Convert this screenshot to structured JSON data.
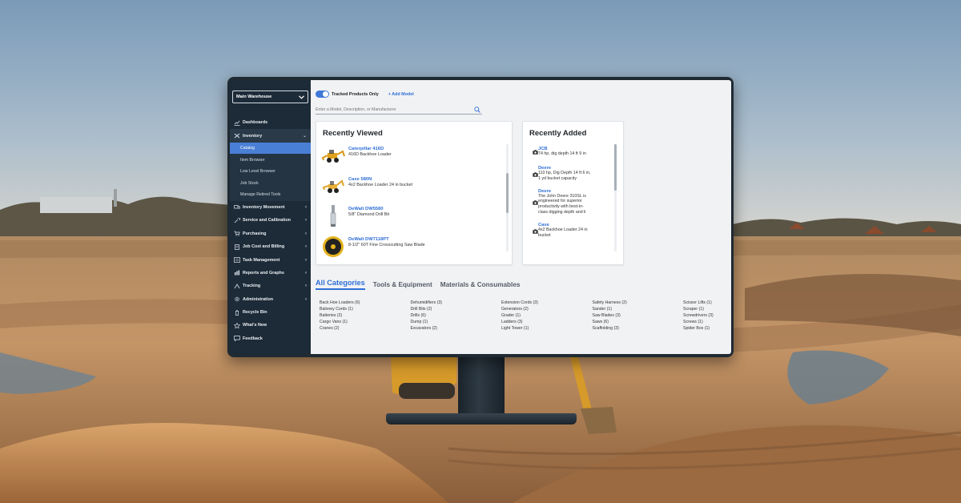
{
  "sidebar": {
    "warehouse": "Main Warehouse",
    "items": [
      {
        "label": "Dashboards",
        "icon": "chart-icon"
      },
      {
        "label": "Inventory",
        "icon": "tools-icon",
        "open": true
      },
      {
        "label": "Inventory Movement",
        "icon": "truck-icon"
      },
      {
        "label": "Service and Calibration",
        "icon": "wrench-icon"
      },
      {
        "label": "Purchasing",
        "icon": "cart-icon"
      },
      {
        "label": "Job Cost and Billing",
        "icon": "document-icon"
      },
      {
        "label": "Task Management",
        "icon": "list-icon"
      },
      {
        "label": "Reports and Graphs",
        "icon": "report-icon"
      },
      {
        "label": "Tracking",
        "icon": "tracking-icon"
      },
      {
        "label": "Administration",
        "icon": "gear-icon"
      },
      {
        "label": "Recycle Bin",
        "icon": "recycle-icon"
      },
      {
        "label": "What's New",
        "icon": "star-icon"
      },
      {
        "label": "Feedback",
        "icon": "chat-icon"
      }
    ],
    "inventory_sub": [
      "Catalog",
      "Item Browser",
      "Low Level Browser",
      "Job Stock",
      "Manage Retired Tools"
    ]
  },
  "topbar": {
    "toggle_label": "Tracked Products Only",
    "add_model": "+ Add Model"
  },
  "search": {
    "placeholder": "Enter a Model, Description, or Manufacturer"
  },
  "recently_viewed": {
    "title": "Recently Viewed",
    "items": [
      {
        "name": "Caterpillar 416D",
        "desc": "416D Backhoe Loader"
      },
      {
        "name": "Case 580N",
        "desc": "4x2 Backhoe Loader 24 in bucket"
      },
      {
        "name": "DeWalt DW5580",
        "desc": "5/8\" Diamond Drill Bit"
      },
      {
        "name": "DeWalt DW7118PT",
        "desc": "8-1/2\" 60T Fine Crosscutting Saw Blade"
      }
    ]
  },
  "recently_added": {
    "title": "Recently Added",
    "items": [
      {
        "name": "JCB",
        "desc": [
          "74 hp, dig depth 14 ft 9 in"
        ]
      },
      {
        "name": "Deere",
        "desc": [
          "110 hp, Dig Depth 14 ft 6 in,",
          "1 yd bucket capacity"
        ]
      },
      {
        "name": "Deere",
        "desc": [
          "The John Deere 310SL is",
          "engineered for superior",
          "productivity with best-in-",
          "class digging depth and li"
        ]
      },
      {
        "name": "Case",
        "desc": [
          "4x2 Backhoe Loader 24 in",
          "bucket"
        ]
      }
    ]
  },
  "tabs": [
    "All Categories",
    "Tools & Equipment",
    "Materials & Consumables"
  ],
  "categories": [
    [
      "Back Hoe Loaders (6)",
      "Baloney Cords (1)",
      "Batteries (2)",
      "Cargo Vans (1)",
      "Cranes (2)"
    ],
    [
      "Dehumidifiers (3)",
      "Drill Bits (2)",
      "Drills (6)",
      "Dump (1)",
      "Excavators (2)"
    ],
    [
      "Extension Cords (3)",
      "Generators (2)",
      "Grader (1)",
      "Ladders (3)",
      "Light Tower (1)"
    ],
    [
      "Safety Harness (2)",
      "Sander (1)",
      "Saw Blades (3)",
      "Saws (6)",
      "Scaffolding (3)"
    ],
    [
      "Scissor Lifts (1)",
      "Scraper (1)",
      "Screwdrivers (3)",
      "Screws (1)",
      "Spider Box (1)"
    ]
  ],
  "colors": {
    "accent": "#2f6fd6",
    "sidebar_bg": "#1d2b38",
    "active_item": "#4a7fd6"
  }
}
